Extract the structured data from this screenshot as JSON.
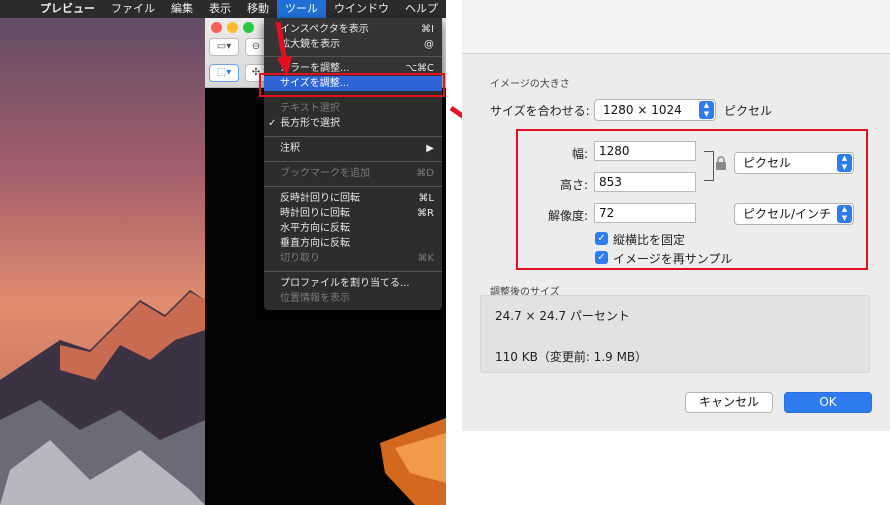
{
  "menubar": {
    "app": "プレビュー",
    "items": [
      "ファイル",
      "編集",
      "表示",
      "移動",
      "ツール",
      "ウインドウ",
      "ヘルプ"
    ],
    "active": "ツール"
  },
  "tools_menu": {
    "items": [
      {
        "label": "インスペクタを表示",
        "shortcut": "⌘I",
        "state": "normal"
      },
      {
        "label": "拡大鏡を表示",
        "shortcut": "@",
        "state": "normal"
      },
      {
        "label": "カラーを調整...",
        "shortcut": "⌥⌘C",
        "state": "normal"
      },
      {
        "label": "サイズを調整...",
        "shortcut": "",
        "state": "selected"
      },
      {
        "label": "テキスト選択",
        "shortcut": "",
        "state": "disabled"
      },
      {
        "label": "長方形で選択",
        "shortcut": "",
        "state": "checked"
      },
      {
        "label": "注釈",
        "shortcut": "▶",
        "state": "normal"
      },
      {
        "label": "ブックマークを追加",
        "shortcut": "⌘D",
        "state": "disabled"
      },
      {
        "label": "反時計回りに回転",
        "shortcut": "⌘L",
        "state": "normal"
      },
      {
        "label": "時計回りに回転",
        "shortcut": "⌘R",
        "state": "normal"
      },
      {
        "label": "水平方向に反転",
        "shortcut": "",
        "state": "normal"
      },
      {
        "label": "垂直方向に反転",
        "shortcut": "",
        "state": "normal"
      },
      {
        "label": "切り取り",
        "shortcut": "⌘K",
        "state": "disabled"
      },
      {
        "label": "プロファイルを割り当てる...",
        "shortcut": "",
        "state": "normal"
      },
      {
        "label": "位置情報を表示",
        "shortcut": "",
        "state": "disabled"
      }
    ],
    "check_mark": "✓"
  },
  "dialog": {
    "image_size_caption": "イメージの大きさ",
    "fit_label": "サイズを合わせる:",
    "fit_value": "1280 × 1024",
    "fit_unit": "ピクセル",
    "width_label": "幅:",
    "width_value": "1280",
    "height_label": "高さ:",
    "height_value": "853",
    "size_unit": "ピクセル",
    "resolution_label": "解像度:",
    "resolution_value": "72",
    "resolution_unit": "ピクセル/インチ",
    "scale_proportionally": "縦横比を固定",
    "resample": "イメージを再サンプル",
    "result_caption": "調整後のサイズ",
    "result_percent": "24.7 × 24.7 パーセント",
    "result_size": "110 KB（変更前: 1.9 MB）",
    "cancel": "キャンセル",
    "ok": "OK"
  },
  "icons": {
    "apple": "",
    "lock": "lock-icon",
    "stepper": "stepper-icon",
    "checkbox_mark": "✓"
  },
  "colors": {
    "highlight_red": "#e4101f",
    "accent_blue": "#2f7cf0",
    "menu_selection": "#2e64d6"
  }
}
